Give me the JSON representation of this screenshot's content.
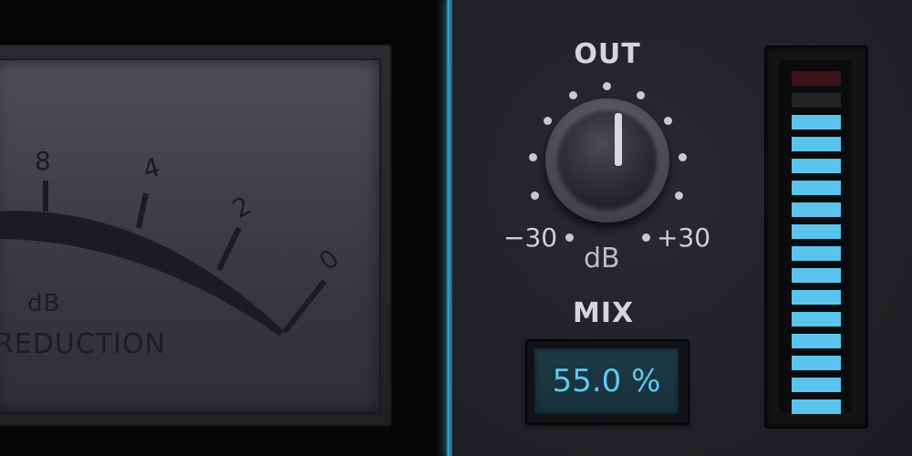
{
  "gr_meter": {
    "scale": [
      {
        "label": "8"
      },
      {
        "label": "4"
      },
      {
        "label": "2"
      },
      {
        "label": "0"
      }
    ],
    "unit": "dB",
    "title": "REDUCTION"
  },
  "output": {
    "label": "OUT",
    "min_label": "−30",
    "max_label": "+30",
    "unit": "dB",
    "knob_value_db": 0
  },
  "mix": {
    "label": "MIX",
    "value": "55.0 %"
  },
  "level_meter": {
    "segments_total": 16,
    "segments_lit": 14,
    "colors": {
      "lit": "#5bc4ec",
      "clip": "#3a1218",
      "off": "#222325"
    }
  },
  "colors": {
    "accent": "#5fc7ef",
    "divider": "#3b9ec4"
  },
  "icons": {
    "knob": "rotary-knob-icon",
    "needle": "meter-needle"
  }
}
